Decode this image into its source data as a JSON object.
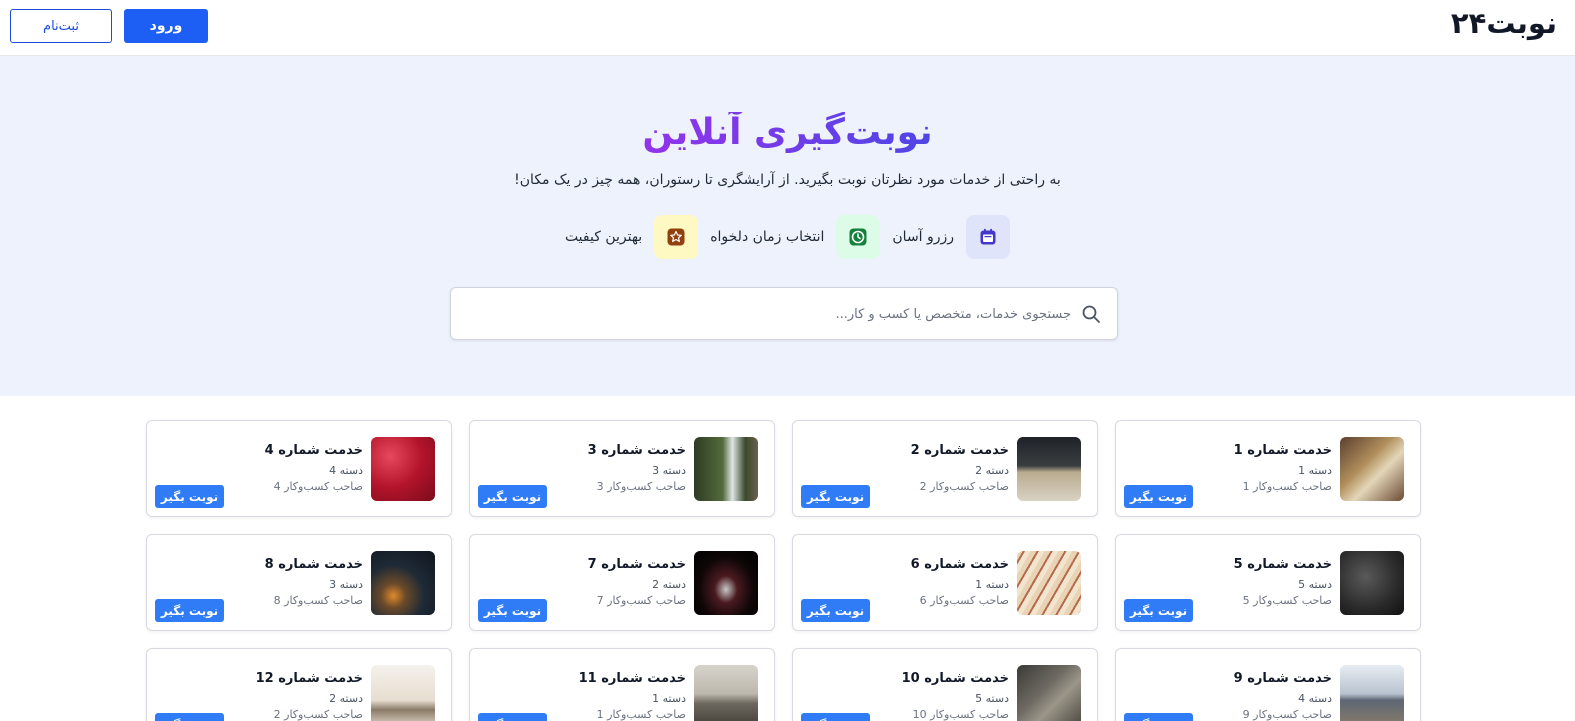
{
  "header": {
    "logo": "نوبت۲۴",
    "login_label": "ورود",
    "register_label": "ثبت‌نام"
  },
  "hero": {
    "title": "نوبت‌گیری آنلاین",
    "subtitle": "به راحتی از خدمات مورد نظرتان نوبت بگیرید. از آرایشگری تا رستوران، همه چیز در یک مکان!",
    "features": [
      {
        "label": "رزرو آسان",
        "icon": "calendar-icon"
      },
      {
        "label": "انتخاب زمان دلخواه",
        "icon": "clock-icon"
      },
      {
        "label": "بهترین کیفیت",
        "icon": "star-icon"
      }
    ]
  },
  "search": {
    "placeholder": "جستجوی خدمات، متخصص یا کسب و کار..."
  },
  "cards": [
    {
      "title": "خدمت شماره 1",
      "category": "دسته 1",
      "owner": "صاحب کسب‌وکار 1",
      "button": "نوبت بگیر"
    },
    {
      "title": "خدمت شماره 2",
      "category": "دسته 2",
      "owner": "صاحب کسب‌وکار 2",
      "button": "نوبت بگیر"
    },
    {
      "title": "خدمت شماره 3",
      "category": "دسته 3",
      "owner": "صاحب کسب‌وکار 3",
      "button": "نوبت بگیر"
    },
    {
      "title": "خدمت شماره 4",
      "category": "دسته 4",
      "owner": "صاحب کسب‌وکار 4",
      "button": "نوبت بگیر"
    },
    {
      "title": "خدمت شماره 5",
      "category": "دسته 5",
      "owner": "صاحب کسب‌وکار 5",
      "button": "نوبت بگیر"
    },
    {
      "title": "خدمت شماره 6",
      "category": "دسته 1",
      "owner": "صاحب کسب‌وکار 6",
      "button": "نوبت بگیر"
    },
    {
      "title": "خدمت شماره 7",
      "category": "دسته 2",
      "owner": "صاحب کسب‌وکار 7",
      "button": "نوبت بگیر"
    },
    {
      "title": "خدمت شماره 8",
      "category": "دسته 3",
      "owner": "صاحب کسب‌وکار 8",
      "button": "نوبت بگیر"
    },
    {
      "title": "خدمت شماره 9",
      "category": "دسته 4",
      "owner": "صاحب کسب‌وکار 9",
      "button": "نوبت بگیر"
    },
    {
      "title": "خدمت شماره 10",
      "category": "دسته 5",
      "owner": "صاحب کسب‌وکار 10",
      "button": "نوبت بگیر"
    },
    {
      "title": "خدمت شماره 11",
      "category": "دسته 1",
      "owner": "صاحب کسب‌وکار 1",
      "button": "نوبت بگیر"
    },
    {
      "title": "خدمت شماره 12",
      "category": "دسته 2",
      "owner": "صاحب کسب‌وکار 2",
      "button": "نوبت بگیر"
    }
  ],
  "colors": {
    "primary": "#1d5ff5",
    "card_button": "#2f7cf6",
    "hero_bg": "#eef2fd",
    "feature_calendar_bg": "#e0e4fb",
    "feature_clock_bg": "#dcfce7",
    "feature_star_bg": "#fef9c3"
  }
}
